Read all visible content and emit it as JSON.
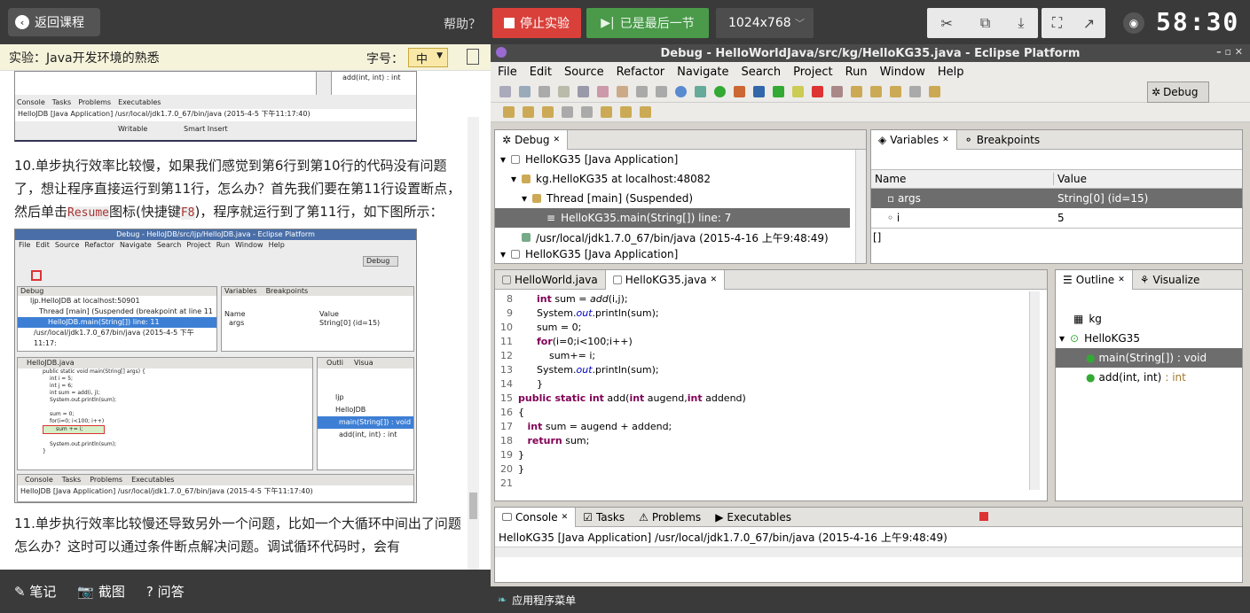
{
  "top": {
    "back": "返回课程",
    "help": "帮助？",
    "stop": "停止实验",
    "last": "已是最后一节",
    "resolution": "1024x768",
    "timer": "58:30"
  },
  "lesson": {
    "title": "实验：Java开发环境的熟悉",
    "font_label": "字号：",
    "font_value": "中",
    "p10_a": "10.单步执行效率比较慢，如果我们感觉到第6行到第10行的代码没有问题了，想让程序直接运行到第11行，怎么办？首先我们要在第11行设置断点，然后单击",
    "p10_code1": "Resume",
    "p10_b": "图标(快捷键",
    "p10_code2": "F8",
    "p10_c": ")，程序就运行到了第11行，如下图所示：",
    "p11": "11.单步执行效率比较慢还导致另外一个问题，比如一个大循环中间出了问题怎么办？这时可以通过条件断点解决问题。调试循环代码时，会有",
    "shot1": {
      "outline_item": "add(int, int) : int",
      "tabs": [
        "Console",
        "Tasks",
        "Problems",
        "Executables"
      ],
      "console_line": "HelloJDB [Java Application] /usr/local/jdk1.7.0_67/bin/java (2015-4-5 下午11:17:40)",
      "status1": "Writable",
      "status2": "Smart Insert"
    },
    "shot2": {
      "title": "Debug - HelloJDB/src/ljp/HelloJDB.java - Eclipse Platform",
      "menu": [
        "File",
        "Edit",
        "Source",
        "Refactor",
        "Navigate",
        "Search",
        "Project",
        "Run",
        "Window",
        "Help"
      ],
      "perspective": "Debug",
      "debug_tab": "Debug",
      "vars_tab": "Variables",
      "bp_tab": "Breakpoints",
      "tree": [
        "ljp.HelloJDB at localhost:50901",
        "Thread [main] (Suspended (breakpoint at line 11",
        "HelloJDB.main(String[]) line: 11",
        "/usr/local/jdk1.7.0_67/bin/java (2015-4-5 下午11:17:"
      ],
      "var_header": [
        "Name",
        "Value"
      ],
      "var_row": [
        "args",
        "String[0]  (id=15)"
      ],
      "editor_tab": "HelloJDB.java",
      "code": [
        "public static void main(String[] args) {",
        "int i = 5;",
        "int j = 6;",
        "int sum = add(i, j);",
        "System.out.println(sum);",
        "",
        "sum = 0;",
        "for(i=0; i<100; i++)",
        "sum += i;",
        "",
        "System.out.println(sum);",
        "}"
      ],
      "outline_tab": "Outli",
      "visualize_tab": "Visua",
      "outline_items": [
        "ljp",
        "HelloJDB",
        "main(String[]) : void",
        "add(int, int) : int"
      ],
      "bottom_tabs": [
        "Console",
        "Tasks",
        "Problems",
        "Executables"
      ],
      "console_line": "HelloJDB [Java Application] /usr/local/jdk1.7.0_67/bin/java (2015-4-5 下午11:17:40)"
    }
  },
  "bottom_left": {
    "notes": "笔记",
    "screenshot": "截图",
    "qa": "问答"
  },
  "eclipse": {
    "title": "Debug - HelloWorldJava/src/kg/HelloKG35.java - Eclipse Platform",
    "menu": [
      "File",
      "Edit",
      "Source",
      "Refactor",
      "Navigate",
      "Search",
      "Project",
      "Run",
      "Window",
      "Help"
    ],
    "perspective": "Debug",
    "debug_tab": "Debug",
    "debug_tree": [
      "HelloKG35 [Java Application]",
      "kg.HelloKG35 at localhost:48082",
      "Thread [main] (Suspended)",
      "HelloKG35.main(String[]) line: 7",
      "/usr/local/jdk1.7.0_67/bin/java (2015-4-16 上午9:48:49)",
      "HelloKG35 [Java Application]"
    ],
    "vars_tab": "Variables",
    "bp_tab": "Breakpoints",
    "var_cols": [
      "Name",
      "Value"
    ],
    "vars": [
      {
        "name": "args",
        "value": "String[0]  (id=15)"
      },
      {
        "name": "i",
        "value": "5"
      }
    ],
    "var_detail": "[]",
    "editor_tabs": [
      "HelloWorld.java",
      "HelloKG35.java"
    ],
    "outline_tab": "Outline",
    "visualize_tab": "Visualize",
    "outline": [
      "kg",
      "HelloKG35",
      "main(String[]) : void",
      "add(int, int)"
    ],
    "outline_ret": ": int",
    "console_tabs": [
      "Console",
      "Tasks",
      "Problems",
      "Executables"
    ],
    "console_line": "HelloKG35 [Java Application] /usr/local/jdk1.7.0_67/bin/java (2015-4-16 上午9:48:49)",
    "status": "应用程序菜单"
  }
}
